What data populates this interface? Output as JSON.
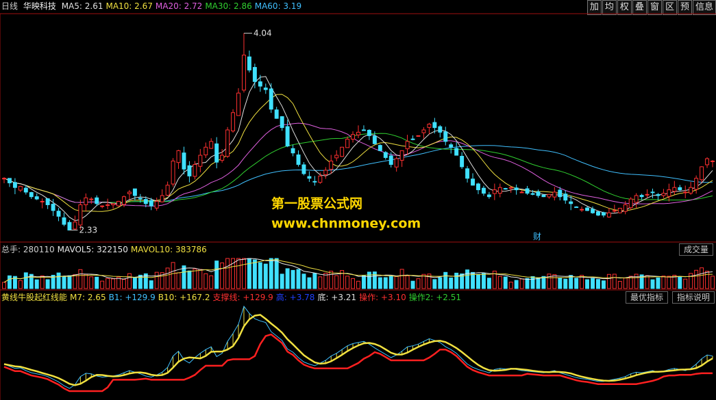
{
  "header": {
    "period": "日线",
    "stock": "华映科技",
    "ma": [
      {
        "label": "MA5: 2.61",
        "color": "#e0e0e0"
      },
      {
        "label": "MA10: 2.67",
        "color": "#f0e040"
      },
      {
        "label": "MA20: 2.72",
        "color": "#e060e0"
      },
      {
        "label": "MA30: 2.86",
        "color": "#30d030"
      },
      {
        "label": "MA60: 3.19",
        "color": "#40c0ff"
      }
    ]
  },
  "toolbar": [
    "加",
    "均",
    "权",
    "叠",
    "窗",
    "区",
    "预",
    "信息"
  ],
  "annotations": {
    "high": "4.04",
    "low": "2.33",
    "fin": "财"
  },
  "watermark": {
    "line1": "第一股票公式网",
    "line2": "www.chnmoney.com"
  },
  "volume_header": {
    "items": [
      {
        "label": "总手: 280110",
        "color": "#d0d0d0"
      },
      {
        "label": "MAVOL5: 322150",
        "color": "#e8e8e8"
      },
      {
        "label": "MAVOL10: 383786",
        "color": "#f0e040"
      }
    ],
    "button": "成交量"
  },
  "indicator_header": {
    "items": [
      {
        "label": "黄线牛股起红线能",
        "color": "#f0e040"
      },
      {
        "label": "M7: 2.65",
        "color": "#f0e040"
      },
      {
        "label": "B1: +129.9",
        "color": "#40c0ff"
      },
      {
        "label": "B10: +167.2",
        "color": "#f0e040"
      },
      {
        "label": "支撑线: +129.9",
        "color": "#ff3030"
      },
      {
        "label": "高: +3.78",
        "color": "#2040ff"
      },
      {
        "label": "底: +3.21",
        "color": "#e0e0e0"
      },
      {
        "label": "操作: +3.10",
        "color": "#ff3030"
      },
      {
        "label": "操作2: +2.51",
        "color": "#30d030"
      }
    ],
    "btn1": "最优指标",
    "btn2": "指标说明"
  },
  "chart_data": {
    "type": "candlestick",
    "price_range": [
      2.25,
      4.15
    ],
    "closes": [
      2.78,
      2.74,
      2.7,
      2.71,
      2.66,
      2.62,
      2.6,
      2.58,
      2.55,
      2.5,
      2.45,
      2.38,
      2.33,
      2.4,
      2.55,
      2.61,
      2.6,
      2.56,
      2.54,
      2.55,
      2.56,
      2.58,
      2.62,
      2.66,
      2.63,
      2.6,
      2.56,
      2.54,
      2.58,
      2.63,
      2.72,
      2.93,
      3.02,
      2.86,
      2.8,
      2.9,
      2.98,
      3.05,
      3.1,
      2.92,
      2.98,
      3.2,
      3.35,
      3.52,
      3.85,
      3.72,
      3.62,
      3.58,
      3.55,
      3.38,
      3.3,
      3.22,
      3.06,
      3.0,
      2.9,
      2.82,
      2.78,
      2.75,
      2.8,
      2.85,
      2.93,
      2.98,
      3.05,
      3.12,
      3.16,
      3.18,
      3.2,
      3.15,
      3.08,
      3.02,
      2.96,
      2.9,
      2.95,
      3.02,
      3.1,
      3.12,
      3.15,
      3.2,
      3.25,
      3.22,
      3.18,
      3.1,
      3.05,
      2.98,
      2.88,
      2.78,
      2.72,
      2.68,
      2.65,
      2.62,
      2.68,
      2.7,
      2.69,
      2.7,
      2.68,
      2.66,
      2.65,
      2.64,
      2.63,
      2.62,
      2.64,
      2.66,
      2.62,
      2.59,
      2.56,
      2.53,
      2.51,
      2.5,
      2.48,
      2.46,
      2.46,
      2.48,
      2.5,
      2.52,
      2.55,
      2.6,
      2.63,
      2.62,
      2.64,
      2.66,
      2.63,
      2.65,
      2.68,
      2.7,
      2.68,
      2.66,
      2.7,
      2.78,
      2.88,
      2.95,
      2.93
    ]
  }
}
